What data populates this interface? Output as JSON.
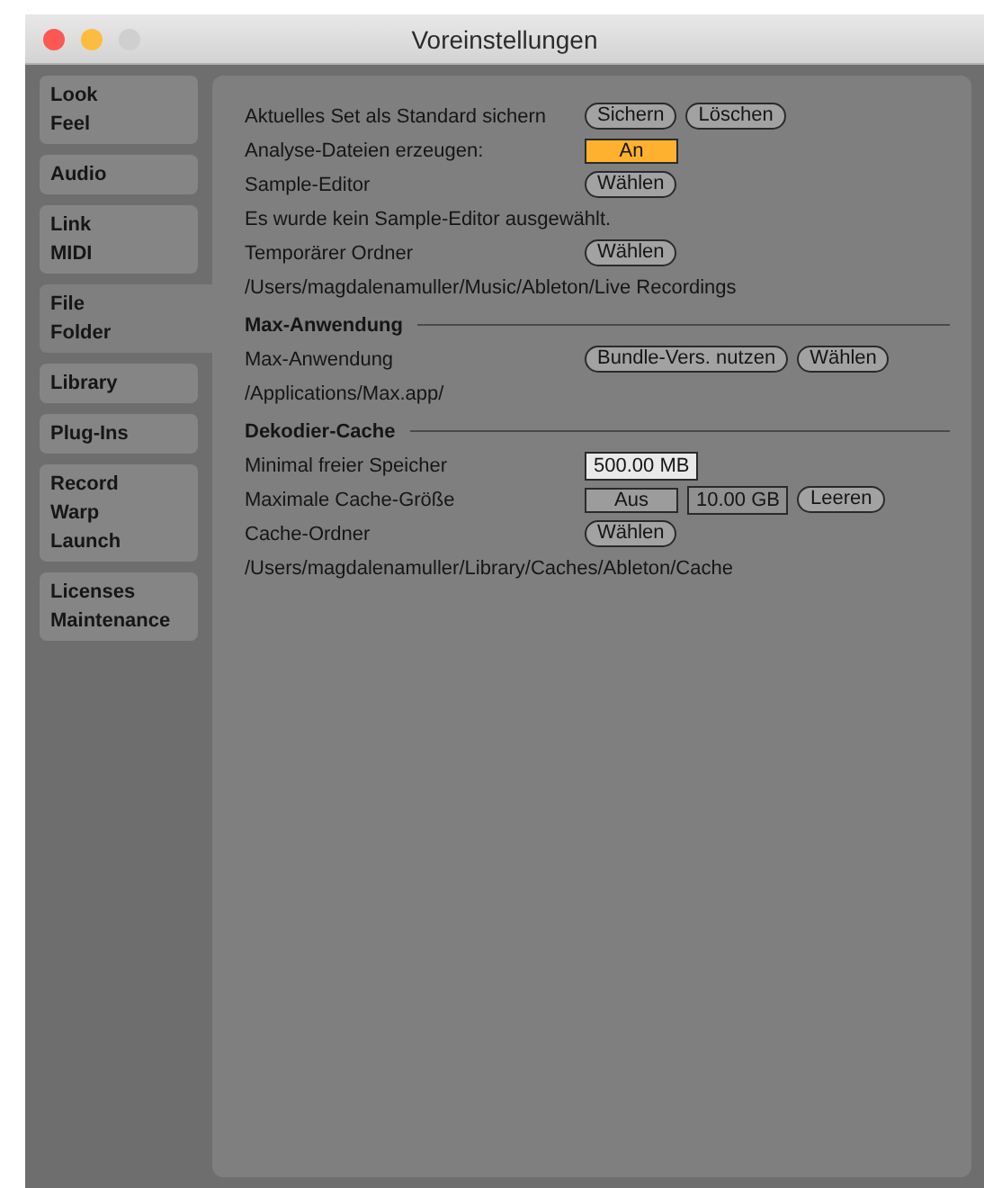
{
  "window": {
    "title": "Voreinstellungen"
  },
  "tabs": [
    {
      "lines": [
        "Look",
        "Feel"
      ],
      "selected": false
    },
    {
      "lines": [
        "Audio"
      ],
      "selected": false
    },
    {
      "lines": [
        "Link",
        "MIDI"
      ],
      "selected": false
    },
    {
      "lines": [
        "File",
        "Folder"
      ],
      "selected": true
    },
    {
      "lines": [
        "Library"
      ],
      "selected": false
    },
    {
      "lines": [
        "Plug-Ins"
      ],
      "selected": false
    },
    {
      "lines": [
        "Record",
        "Warp",
        "Launch"
      ],
      "selected": false
    },
    {
      "lines": [
        "Licenses",
        "Maintenance"
      ],
      "selected": false
    }
  ],
  "rows": [
    {
      "kind": "setting",
      "label": "Aktuelles Set als Standard sichern",
      "controls": [
        {
          "kind": "button",
          "label": "Sichern"
        },
        {
          "kind": "button",
          "label": "Löschen"
        }
      ]
    },
    {
      "kind": "setting",
      "label": "Analyse-Dateien erzeugen:",
      "controls": [
        {
          "kind": "toggle",
          "label": "An",
          "on": true
        }
      ]
    },
    {
      "kind": "setting",
      "label": "Sample-Editor",
      "controls": [
        {
          "kind": "button",
          "label": "Wählen"
        }
      ]
    },
    {
      "kind": "text",
      "text": "Es wurde kein Sample-Editor ausgewählt."
    },
    {
      "kind": "setting",
      "label": "Temporärer Ordner",
      "controls": [
        {
          "kind": "button",
          "label": "Wählen"
        }
      ]
    },
    {
      "kind": "text",
      "text": "/Users/magdalenamuller/Music/Ableton/Live Recordings"
    },
    {
      "kind": "section",
      "text": "Max-Anwendung"
    },
    {
      "kind": "setting",
      "label": "Max-Anwendung",
      "controls": [
        {
          "kind": "button",
          "label": "Bundle-Vers. nutzen"
        },
        {
          "kind": "button",
          "label": "Wählen"
        }
      ]
    },
    {
      "kind": "text",
      "text": "/Applications/Max.app/"
    },
    {
      "kind": "section",
      "text": "Dekodier-Cache"
    },
    {
      "kind": "setting",
      "label": "Minimal freier Speicher",
      "controls": [
        {
          "kind": "field",
          "value": "500.00 MB"
        }
      ]
    },
    {
      "kind": "setting",
      "label": "Maximale Cache-Größe",
      "controls": [
        {
          "kind": "toggle",
          "label": "Aus",
          "on": false
        },
        {
          "kind": "field",
          "value": "10.00 GB",
          "dim": true
        },
        {
          "kind": "button",
          "label": "Leeren"
        }
      ]
    },
    {
      "kind": "setting",
      "label": "Cache-Ordner",
      "controls": [
        {
          "kind": "button",
          "label": "Wählen"
        }
      ]
    },
    {
      "kind": "text",
      "text": "/Users/magdalenamuller/Library/Caches/Ableton/Cache"
    }
  ]
}
